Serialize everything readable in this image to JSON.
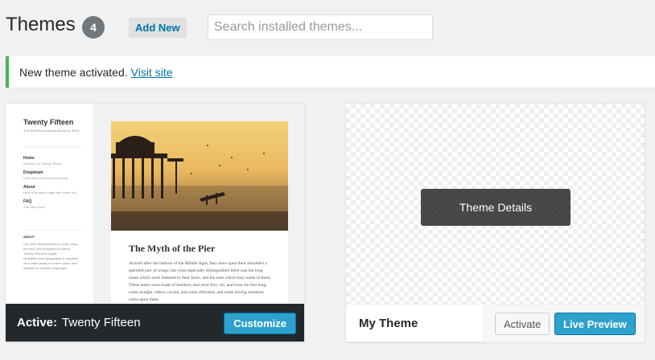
{
  "header": {
    "title": "Themes",
    "count": "4",
    "add_new_label": "Add New",
    "search_placeholder": "Search installed themes..."
  },
  "notice": {
    "message": "New theme activated.",
    "link_label": "Visit site"
  },
  "themes": [
    {
      "active_label": "Active:",
      "name": "Twenty Fifteen",
      "customize_label": "Customize",
      "screenshot": {
        "site_name": "Twenty Fifteen",
        "tagline": "The WordPress default theme for 2015.",
        "menu": [
          {
            "label": "Home",
            "sub": "Welcome to Twenty Fifteen"
          },
          {
            "label": "Dropdown",
            "sub": "Little menu with submenu items"
          },
          {
            "label": "About",
            "sub": "Here is an about page with some info"
          },
          {
            "label": "FAQ",
            "sub": "The Help Desk"
          }
        ],
        "about_heading": "ABOUT",
        "about_text": "Our 2015 default theme is clean, blog-focused, and designed for clarity. Twenty Fifteen's simple, straightforward typography is readable on a wide variety of screen sizes, and suitable for multiple languages.",
        "post_title": "The Myth of the Pier",
        "post_body": "Arrived after the fashion of the Middle Ages, they have upon their shoulders a splendid pair of wings; but what especially distinguished them was the long noses which were fastened to their faces, and the uses which they made of them. These noses were made of bamboo, and were five, six, and even ten feet long, some straight, others curved, and some ribboned, and some having imitation warts upon them."
      }
    },
    {
      "name": "My Theme",
      "details_label": "Theme Details",
      "activate_label": "Activate",
      "live_preview_label": "Live Preview"
    }
  ],
  "colors": {
    "accent_blue": "#2ea2cc",
    "link_blue": "#0073aa",
    "notice_green": "#46b450",
    "active_bar": "#23282d"
  }
}
